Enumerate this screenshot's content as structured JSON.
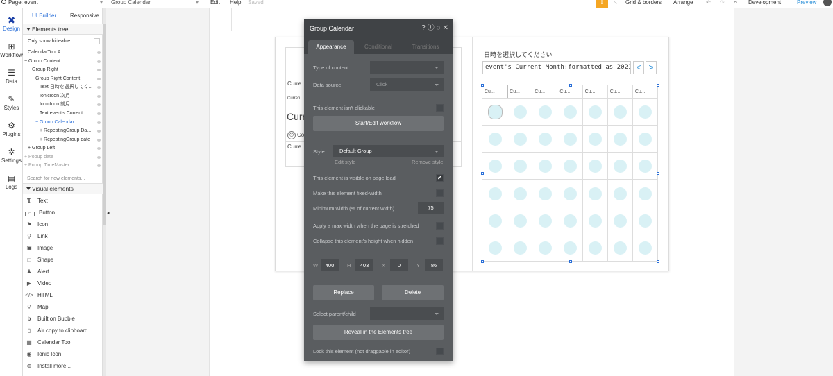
{
  "topbar": {
    "page_label": "Page: event",
    "element_select": "Group Calendar",
    "menu_edit": "Edit",
    "menu_help": "Help",
    "saved": "Saved",
    "grid_borders": "Grid & borders",
    "arrange": "Arrange",
    "environment": "Development",
    "preview": "Preview"
  },
  "icon_tabs": [
    "Design",
    "Workflow",
    "Data",
    "Styles",
    "Plugins",
    "Settings",
    "Logs"
  ],
  "builder_tabs": {
    "ui_builder": "UI Builder",
    "responsive": "Responsive"
  },
  "elements_tree": {
    "header": "Elements tree",
    "only_show_hideable": "Only show hideable",
    "items": [
      "CalendarTool A",
      "Group Content",
      "Group Right",
      "Group Right Content",
      "Text 日時を選択してく...",
      "IonicIcon 次月",
      "IonicIcon 前月",
      "Text event's Current ...",
      "Group Calendar",
      "RepeatingGroup Da...",
      "RepeatingGroup date",
      "Group Left",
      "Popup date",
      "Popup TimeMaster"
    ],
    "search_placeholder": "Search for new elements..."
  },
  "visual_elements": {
    "header": "Visual elements",
    "items": [
      "Text",
      "Button",
      "Icon",
      "Link",
      "Image",
      "Shape",
      "Alert",
      "Video",
      "HTML",
      "Map",
      "Built on Bubble",
      "Air copy to clipboard",
      "Calendar Tool",
      "Ionic Icon",
      "Install more..."
    ]
  },
  "canvas": {
    "left_texts": [
      "Curre",
      "Curren",
      "Curr",
      "Co",
      "Curre"
    ],
    "calendar_title": "日時を選択してください",
    "month_expr": "event's Current Month:formatted as 2021...",
    "prev_icon": "<",
    "next_icon": ">",
    "day_header": "Cu...",
    "rows": 6,
    "cols": 7
  },
  "panel": {
    "title": "Group Calendar",
    "tabs": [
      "Appearance",
      "Conditional",
      "Transitions"
    ],
    "type_of_content_label": "Type of content",
    "data_source_label": "Data source",
    "data_source_value": "Click",
    "not_clickable_label": "This element isn't clickable",
    "workflow_button": "Start/Edit workflow",
    "style_label": "Style",
    "style_value": "Default Group",
    "edit_style": "Edit style",
    "remove_style": "Remove style",
    "visible_label": "This element is visible on page load",
    "fixed_width_label": "Make this element fixed-width",
    "min_width_label": "Minimum width (% of current width)",
    "min_width_value": "75",
    "max_width_label": "Apply a max width when the page is stretched",
    "collapse_label": "Collapse this element's height when hidden",
    "w_label": "W",
    "w_value": "400",
    "h_label": "H",
    "h_value": "403",
    "x_label": "X",
    "x_value": "0",
    "y_label": "Y",
    "y_value": "86",
    "replace_button": "Replace",
    "delete_button": "Delete",
    "parent_label": "Select parent/child",
    "reveal_button": "Reveal in the Elements tree",
    "lock_label": "Lock this element (not draggable in editor)"
  },
  "colors": {
    "accent": "#2a6fd8",
    "panel_bg": "#5a5d60",
    "dot": "#d9f1f5",
    "upgrade": "#f5a623"
  }
}
